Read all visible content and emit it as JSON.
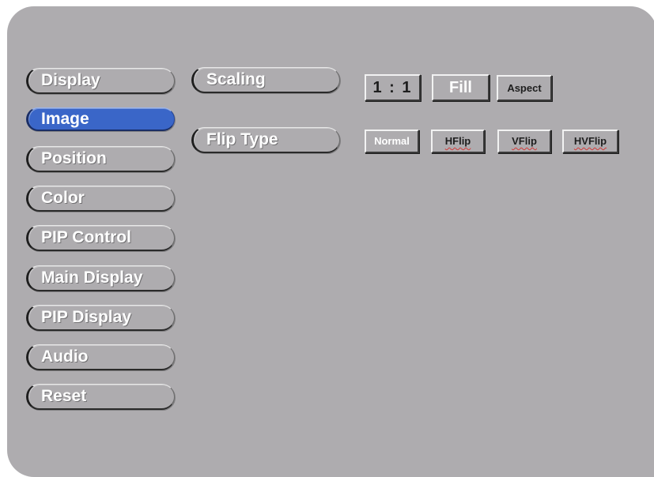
{
  "menu": {
    "items": [
      {
        "id": "display",
        "label": "Display",
        "selected": false
      },
      {
        "id": "image",
        "label": "Image",
        "selected": true
      },
      {
        "id": "position",
        "label": "Position",
        "selected": false
      },
      {
        "id": "color",
        "label": "Color",
        "selected": false
      },
      {
        "id": "pip-control",
        "label": "PIP Control",
        "selected": false
      },
      {
        "id": "main-display",
        "label": "Main Display",
        "selected": false
      },
      {
        "id": "pip-display",
        "label": "PIP Display",
        "selected": false
      },
      {
        "id": "audio",
        "label": "Audio",
        "selected": false
      },
      {
        "id": "reset",
        "label": "Reset",
        "selected": false
      }
    ]
  },
  "settings": {
    "scaling": {
      "label": "Scaling",
      "options": [
        "1 : 1",
        "Fill",
        "Aspect"
      ],
      "highlighted": "Fill"
    },
    "flip_type": {
      "label": "Flip Type",
      "options": [
        "Normal",
        "HFlip",
        "VFlip",
        "HVFlip"
      ],
      "highlighted": "Normal"
    }
  },
  "colors": {
    "panel_background": "#aeacaf",
    "selected_item": "#3a66c8",
    "text_light": "#ffffff",
    "text_dark": "#1e1e1e"
  }
}
